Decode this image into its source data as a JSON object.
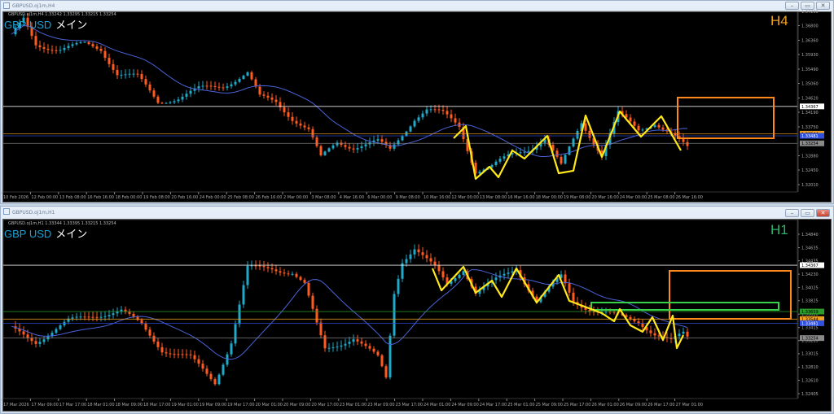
{
  "windows": [
    {
      "title": "GBPUSD.oj1m,H4",
      "info": "GBPUSD.oj1m,H4  1.33242 1.33295 1.33215 1.33254",
      "symbol": "GBP USD",
      "label": "メイン",
      "timeframe": "H4",
      "timeframe_color": "#f0a020",
      "buttons": [
        "–",
        "▭",
        "✕"
      ]
    },
    {
      "title": "GBPUSD.oj1m,H1",
      "info": "GBPUSD.oj1m,H1  1.33344 1.33395 1.33215 1.33254",
      "symbol": "GBP USD",
      "label": "メイン",
      "timeframe": "H1",
      "timeframe_color": "#2fb36b",
      "buttons": [
        "–",
        "▭",
        "✕"
      ]
    }
  ],
  "colors": {
    "bull": "#20a9c9",
    "bear": "#ff5a1f",
    "ma": "#4a63d8",
    "zigzag": "#ffe81a",
    "box": "#ff8a1c",
    "green": "#39d34a"
  },
  "chart_data": [
    {
      "type": "candlestick",
      "title": "GBPUSD H4",
      "ylim": [
        1.3201,
        1.3723
      ],
      "y_ticks": [
        "1.37230",
        "1.36800",
        "1.36360",
        "1.35930",
        "1.35490",
        "1.35060",
        "1.34620",
        "1.34190",
        "1.33750",
        "1.32880",
        "1.32450",
        "1.32010"
      ],
      "x_ticks": [
        "10 Feb 2026",
        "12 Feb 00:00",
        "13 Feb 08:00",
        "16 Feb 16:00",
        "18 Feb 00:00",
        "19 Feb 08:00",
        "20 Feb 16:00",
        "24 Feb 00:00",
        "25 Feb 08:00",
        "26 Feb 16:00",
        "2 Mar 00:00",
        "3 Mar 08:00",
        "4 Mar 16:00",
        "6 Mar 00:00",
        "9 Mar 08:00",
        "10 Mar 16:00",
        "12 Mar 00:00",
        "13 Mar 08:00",
        "16 Mar 16:00",
        "18 Mar 00:00",
        "19 Mar 08:00",
        "20 Mar 16:00",
        "24 Mar 00:00",
        "25 Mar 08:00",
        "26 Mar 16:00"
      ],
      "close_keypoints": [
        [
          2,
          1.3647
        ],
        [
          5,
          1.3696
        ],
        [
          8,
          1.3623
        ],
        [
          14,
          1.361
        ],
        [
          20,
          1.3623
        ],
        [
          24,
          1.361
        ],
        [
          28,
          1.3537
        ],
        [
          33,
          1.3525
        ],
        [
          38,
          1.3451
        ],
        [
          43,
          1.3463
        ],
        [
          48,
          1.3488
        ],
        [
          54,
          1.35
        ],
        [
          60,
          1.3537
        ],
        [
          63,
          1.3463
        ],
        [
          67,
          1.3451
        ],
        [
          71,
          1.3402
        ],
        [
          75,
          1.3365
        ],
        [
          78,
          1.328
        ],
        [
          82,
          1.3329
        ],
        [
          86,
          1.3316
        ],
        [
          92,
          1.3329
        ],
        [
          95,
          1.3304
        ],
        [
          98,
          1.3353
        ],
        [
          101,
          1.3402
        ],
        [
          104,
          1.3427
        ],
        [
          108,
          1.3414
        ],
        [
          112,
          1.3378
        ],
        [
          116,
          1.3243
        ],
        [
          120,
          1.3255
        ],
        [
          125,
          1.3292
        ],
        [
          130,
          1.3316
        ],
        [
          133,
          1.3341
        ],
        [
          137,
          1.3255
        ],
        [
          142,
          1.339
        ],
        [
          147,
          1.3292
        ],
        [
          151,
          1.3414
        ],
        [
          156,
          1.3365
        ],
        [
          160,
          1.339
        ],
        [
          164,
          1.3353
        ],
        [
          168,
          1.3309
        ]
      ],
      "ma_period": 20,
      "zigzag": [
        [
          110.6,
          1.33407
        ],
        [
          113.6,
          1.33775
        ],
        [
          116,
          1.32183
        ],
        [
          119.4,
          1.3255
        ],
        [
          121.6,
          1.32232
        ],
        [
          125,
          1.3304
        ],
        [
          128,
          1.32795
        ],
        [
          133.6,
          1.33481
        ],
        [
          136.4,
          1.32354
        ],
        [
          140,
          1.32428
        ],
        [
          143,
          1.34094
        ],
        [
          147,
          1.32844
        ],
        [
          151.4,
          1.34216
        ],
        [
          156.6,
          1.33457
        ],
        [
          161.6,
          1.3407
        ],
        [
          166.4,
          1.3304
        ]
      ],
      "boxes": [
        {
          "x": [
            165.6,
            189.2
          ],
          "y": [
            1.33407,
            1.34633
          ],
          "color": "box"
        }
      ],
      "hlines": [
        {
          "price": 1.34367,
          "label": "1.34367",
          "color": "#ffffff",
          "text": "#000000"
        },
        {
          "price": 1.33544,
          "label": "1.33544",
          "color": "#f0a020",
          "text": "#000000"
        },
        {
          "price": 1.33481,
          "label": "1.33481",
          "color": "#3050e0",
          "text": "#ffffff"
        },
        {
          "price": 1.33254,
          "label": "1.33254",
          "color": "#8a8a8a",
          "text": "#000000"
        }
      ]
    },
    {
      "type": "candlestick",
      "title": "GBPUSD H1",
      "ylim": [
        1.32405,
        1.3484
      ],
      "y_ticks": [
        "1.34840",
        "1.34635",
        "1.34435",
        "1.34230",
        "1.34025",
        "1.33825",
        "1.33620",
        "1.33415",
        "1.33215",
        "1.33015",
        "1.32810",
        "1.32610",
        "1.32405"
      ],
      "x_ticks": [
        "17 Mar 2026",
        "17 Mar 09:00",
        "17 Mar 17:00",
        "18 Mar 01:00",
        "18 Mar 09:00",
        "18 Mar 17:00",
        "19 Mar 01:00",
        "19 Mar 09:00",
        "19 Mar 17:00",
        "20 Mar 01:00",
        "20 Mar 09:00",
        "20 Mar 17:00",
        "23 Mar 01:00",
        "23 Mar 09:00",
        "23 Mar 17:00",
        "24 Mar 01:00",
        "24 Mar 09:00",
        "24 Mar 17:00",
        "25 Mar 01:00",
        "25 Mar 09:00",
        "25 Mar 17:00",
        "26 Mar 01:00",
        "26 Mar 09:00",
        "26 Mar 17:00",
        "27 Mar 01:00"
      ],
      "close_keypoints": [
        [
          2,
          1.3339
        ],
        [
          8,
          1.332
        ],
        [
          16,
          1.3351
        ],
        [
          22,
          1.336
        ],
        [
          29,
          1.3367
        ],
        [
          34,
          1.3345
        ],
        [
          39,
          1.3308
        ],
        [
          46,
          1.3295
        ],
        [
          52,
          1.3258
        ],
        [
          56,
          1.332
        ],
        [
          60,
          1.3432
        ],
        [
          66,
          1.3432
        ],
        [
          71,
          1.3426
        ],
        [
          74,
          1.3407
        ],
        [
          77,
          1.3345
        ],
        [
          79,
          1.3308
        ],
        [
          86,
          1.3326
        ],
        [
          92,
          1.3295
        ],
        [
          94,
          1.3264
        ],
        [
          96,
          1.3395
        ],
        [
          98,
          1.3444
        ],
        [
          101,
          1.3463
        ],
        [
          106,
          1.3432
        ],
        [
          109,
          1.3407
        ],
        [
          113,
          1.3432
        ],
        [
          116,
          1.3395
        ],
        [
          126,
          1.3432
        ],
        [
          131,
          1.3382
        ],
        [
          137,
          1.3419
        ],
        [
          140,
          1.3382
        ],
        [
          144,
          1.337
        ],
        [
          152,
          1.3357
        ],
        [
          156,
          1.3351
        ],
        [
          160,
          1.3332
        ],
        [
          164,
          1.332
        ],
        [
          167,
          1.3332
        ],
        [
          168,
          1.3326
        ]
      ],
      "ma_period": 20,
      "zigzag": [
        [
          105.4,
          1.34318
        ],
        [
          107.6,
          1.33983
        ],
        [
          113,
          1.34343
        ],
        [
          116,
          1.33946
        ],
        [
          120,
          1.34132
        ],
        [
          122.4,
          1.33884
        ],
        [
          126,
          1.34318
        ],
        [
          131,
          1.33797
        ],
        [
          136.4,
          1.34219
        ],
        [
          139,
          1.33822
        ],
        [
          147,
          1.33635
        ],
        [
          150,
          1.33511
        ],
        [
          151.4,
          1.33697
        ],
        [
          154,
          1.33449
        ],
        [
          157,
          1.3335
        ],
        [
          159.4,
          1.33573
        ],
        [
          162,
          1.33225
        ],
        [
          164.4,
          1.33598
        ],
        [
          165.4,
          1.33101
        ],
        [
          167,
          1.333
        ]
      ],
      "boxes": [
        {
          "x": [
            163.6,
            193.4
          ],
          "y": [
            1.33548,
            1.34281
          ],
          "color": "box"
        },
        {
          "x": [
            144.4,
            190.4
          ],
          "y": [
            1.33685,
            1.33797
          ],
          "color": "green"
        }
      ],
      "hlines": [
        {
          "price": 1.34367,
          "label": "1.34367",
          "color": "#ffffff",
          "text": "#000000"
        },
        {
          "price": 1.33659,
          "label": "1.33659",
          "color": "#2a9a2a",
          "text": "#000000"
        },
        {
          "price": 1.33544,
          "label": "1.33544",
          "color": "#f0a020",
          "text": "#000000"
        },
        {
          "price": 1.33481,
          "label": "1.33481",
          "color": "#3050e0",
          "text": "#ffffff"
        },
        {
          "price": 1.33254,
          "label": "1.33254",
          "color": "#8a8a8a",
          "text": "#000000"
        }
      ]
    }
  ]
}
